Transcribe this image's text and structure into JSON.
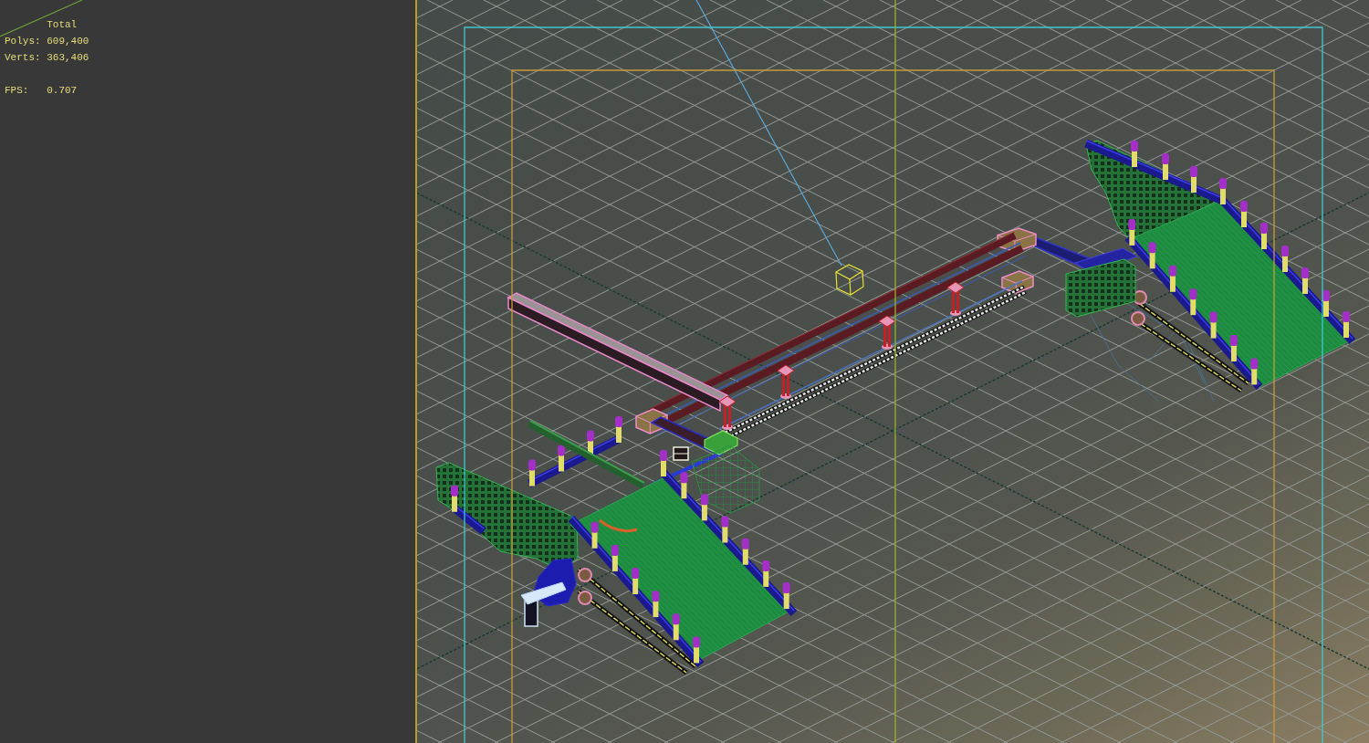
{
  "stats_overlay": {
    "heading": "Total",
    "lines": [
      "Polys: 609,400",
      "Verts: 363,406"
    ],
    "fps": "FPS:   0.707"
  }
}
